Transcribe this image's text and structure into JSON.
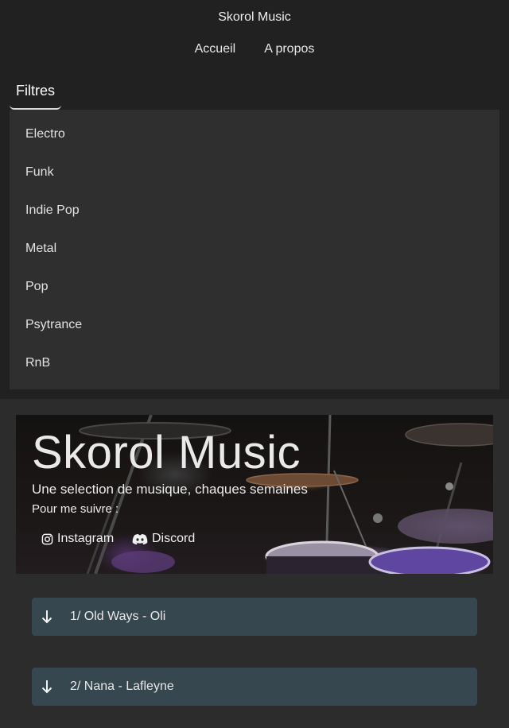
{
  "header": {
    "site_title": "Skorol Music",
    "nav": [
      {
        "label": "Accueil"
      },
      {
        "label": "A propos"
      }
    ]
  },
  "filters": {
    "tab_label": "Filtres",
    "items": [
      "Electro",
      "Funk",
      "Indie Pop",
      "Metal",
      "Pop",
      "Psytrance",
      "RnB"
    ]
  },
  "hero": {
    "title": "Skorol Music",
    "subtitle": "Une selection de musique, chaques semaines",
    "follow_label": "Pour me suivre :",
    "socials": [
      {
        "label": "Instagram",
        "icon": "instagram-icon"
      },
      {
        "label": "Discord",
        "icon": "discord-icon"
      }
    ]
  },
  "tracks": [
    {
      "label": "1/ Old Ways - Oli",
      "icon": "arrow-down-icon"
    },
    {
      "label": "2/ Nana - Lafleyne",
      "icon": "arrow-down-icon"
    }
  ],
  "colors": {
    "page_bg": "#2c2c2c",
    "header_bg": "#212121",
    "panel_bg": "#2f2f2f",
    "track_bg": "#37474f"
  }
}
